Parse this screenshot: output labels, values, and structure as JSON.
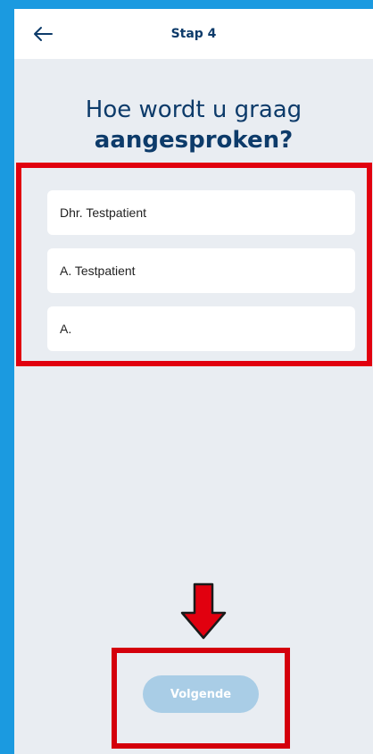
{
  "header": {
    "title": "Stap 4",
    "back_icon": "arrow-left-icon"
  },
  "question": {
    "line1": "Hoe wordt u graag",
    "line2": "aangesproken?"
  },
  "options": [
    {
      "label": "Dhr. Testpatient"
    },
    {
      "label": "A. Testpatient"
    },
    {
      "label": "A."
    }
  ],
  "footer": {
    "next_label": "Volgende",
    "next_enabled": false
  },
  "annotations": {
    "highlight_color": "#e1000f",
    "arrow_icon": "arrow-down-icon"
  },
  "colors": {
    "background": "#1b9ae0",
    "screen": "#e9edf2",
    "title_text": "#0d3b6a",
    "button_disabled": "#a9cde6"
  }
}
